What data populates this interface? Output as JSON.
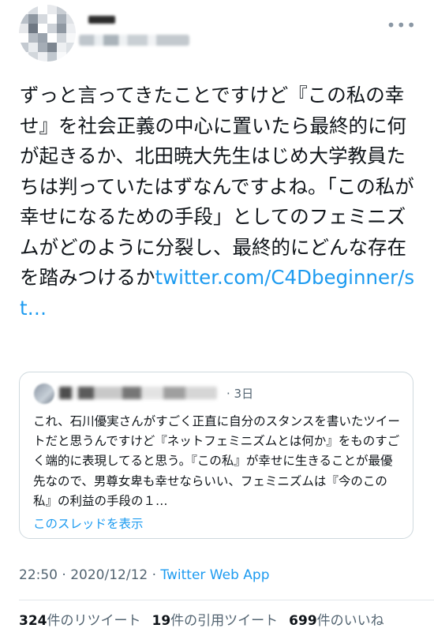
{
  "tweet": {
    "text": "ずっと言ってきたことですけど『この私の幸せ』を社会正義の中心に置いたら最終的に何が起きるか、北田暁大先生はじめ大学教員たちは判っていたはずなんですよね。「この私が幸せになるための手段」としてのフェミニズムがどのように分裂し、最終的にどんな存在を踏みつけるか",
    "link": "twitter.com/C4Dbeginner/st…",
    "more_icon": "more-horizontal-icon"
  },
  "quote": {
    "time": "· 3日",
    "body": "これ、石川優実さんがすごく正直に自分のスタンスを書いたツイートだと思うんですけど『ネットフェミニズムとは何か』をものすごく端的に表現してると思う。『この私』が幸せに生きることが最優先なので、男尊女卑も幸せならいい、フェミニズムは『今のこの私』の利益の手段の１…",
    "thread_link": "このスレッドを表示"
  },
  "meta": {
    "time": "22:50",
    "sep1": " · ",
    "date": "2020/12/12",
    "sep2": " · ",
    "app": "Twitter Web App"
  },
  "stats": {
    "retweets_count": "324",
    "retweets_label": "件のリツイート",
    "quotes_count": "19",
    "quotes_label": "件の引用ツイート",
    "likes_count": "699",
    "likes_label": "件のいいね"
  },
  "colors": {
    "link": "#1d9bf0",
    "secondary_text": "#536471",
    "border": "#cfd9de"
  }
}
